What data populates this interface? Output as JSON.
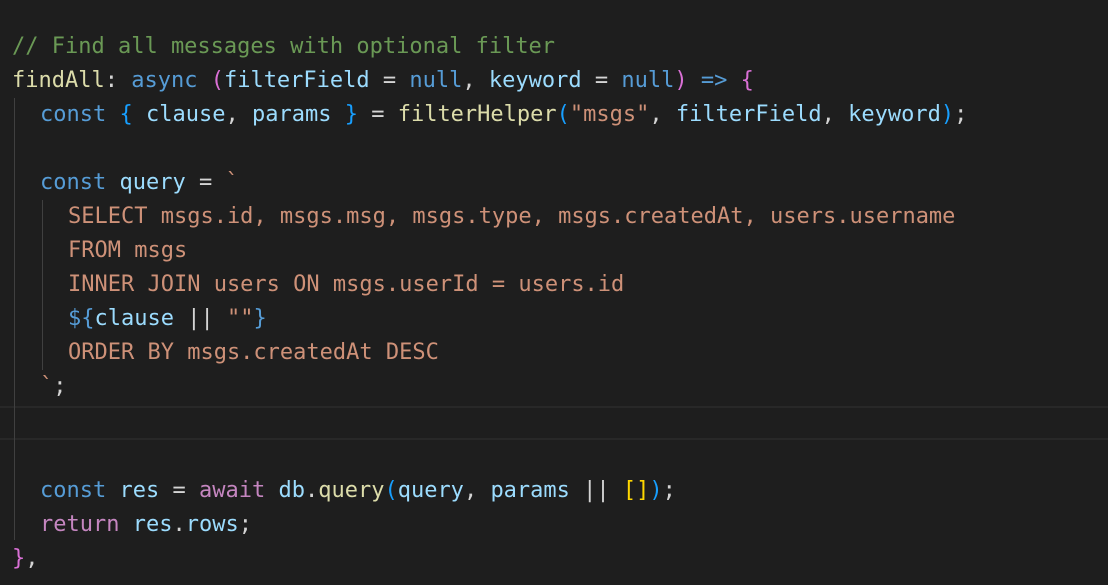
{
  "code": {
    "l1": {
      "comment": "// Find all messages with optional filter"
    },
    "l2": {
      "name": "findAll",
      "colon": ": ",
      "async": "async",
      "sp1": " ",
      "paren_open": "(",
      "param1": "filterField",
      "eq1": " = ",
      "null1": "null",
      "comma": ", ",
      "param2": "keyword",
      "eq2": " = ",
      "null2": "null",
      "paren_close": ")",
      "sp2": " ",
      "arrow": "=>",
      "sp3": " ",
      "brace_open": "{"
    },
    "l3": {
      "const": "const",
      "sp1": " ",
      "brace_open": "{",
      "sp2": " ",
      "clause": "clause",
      "comma1": ", ",
      "params": "params",
      "sp3": " ",
      "brace_close": "}",
      "eq": " = ",
      "fn": "filterHelper",
      "paren_open": "(",
      "str": "\"msgs\"",
      "comma2": ", ",
      "arg1": "filterField",
      "comma3": ", ",
      "arg2": "keyword",
      "paren_close": ")",
      "semi": ";"
    },
    "l5": {
      "const": "const",
      "sp": " ",
      "name": "query",
      "eq": " = ",
      "tick": "`"
    },
    "l6": {
      "sql": "SELECT msgs.id, msgs.msg, msgs.type, msgs.createdAt, users.username"
    },
    "l7": {
      "sql": "FROM msgs"
    },
    "l8": {
      "sql": "INNER JOIN users ON msgs.userId = users.id"
    },
    "l9": {
      "open": "${",
      "var": "clause",
      "op": " || ",
      "str": "\"\"",
      "close": "}"
    },
    "l10": {
      "sql": "ORDER BY msgs.createdAt DESC"
    },
    "l11": {
      "tick": "`",
      "semi": ";"
    },
    "l14": {
      "const": "const",
      "sp": " ",
      "name": "res",
      "eq": " = ",
      "await": "await",
      "sp2": " ",
      "obj": "db",
      "dot": ".",
      "method": "query",
      "paren_open": "(",
      "arg1": "query",
      "comma": ", ",
      "arg2": "params",
      "op": " || ",
      "arr": "[]",
      "paren_close": ")",
      "semi": ";"
    },
    "l15": {
      "return": "return",
      "sp": " ",
      "obj": "res",
      "dot": ".",
      "prop": "rows",
      "semi": ";"
    },
    "l16": {
      "brace_close": "}",
      "comma": ","
    }
  }
}
